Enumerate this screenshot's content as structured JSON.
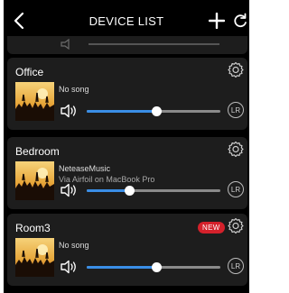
{
  "header": {
    "title": "DEVICE LIST"
  },
  "devices": [
    {
      "name": "Office",
      "song": "No song",
      "source": "",
      "volume_fraction": 0.52,
      "channel_label": "LR",
      "badge": ""
    },
    {
      "name": "Bedroom",
      "song": "NeteaseMusic",
      "source": "Via Airfoil on MacBook Pro",
      "volume_fraction": 0.32,
      "channel_label": "LR",
      "badge": ""
    },
    {
      "name": "Room3",
      "song": "No song",
      "source": "",
      "volume_fraction": 0.52,
      "channel_label": "LR",
      "badge": "NEW"
    }
  ],
  "colors": {
    "accent": "#3a8ee6",
    "card_bg": "#1d1d1d",
    "badge_bg": "#d4212b",
    "track": "#8a8a8a"
  },
  "icons": {
    "back": "chevron-left-icon",
    "add": "plus-icon",
    "refresh": "refresh-icon",
    "settings": "gear-icon",
    "volume": "speaker-icon"
  }
}
